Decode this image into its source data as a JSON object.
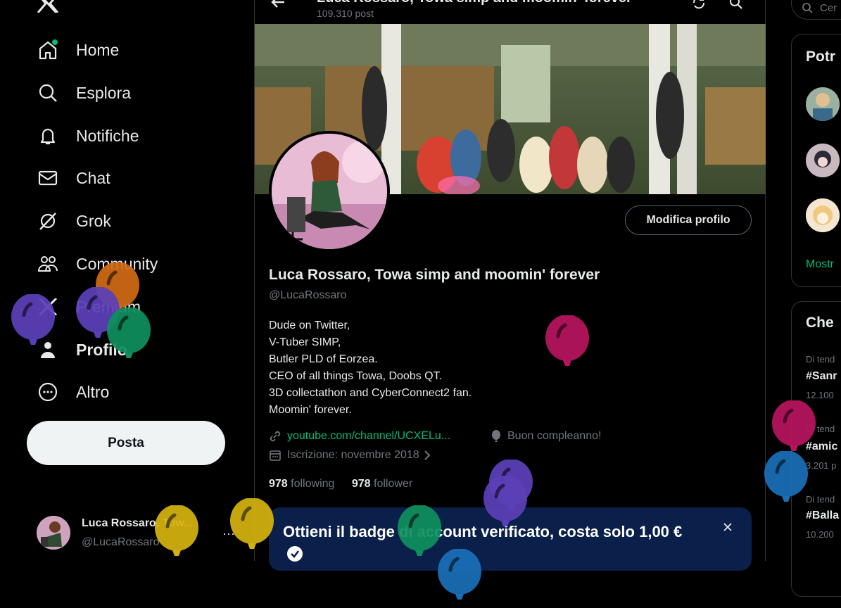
{
  "header": {
    "title": "Luca Rossaro, Towa simp and moomin' forever",
    "post_count": "109.310 post"
  },
  "nav": {
    "items": [
      {
        "label": "Home"
      },
      {
        "label": "Esplora"
      },
      {
        "label": "Notifiche"
      },
      {
        "label": "Chat"
      },
      {
        "label": "Grok"
      },
      {
        "label": "Community"
      },
      {
        "label": "Premium"
      },
      {
        "label": "Profilo"
      },
      {
        "label": "Altro"
      }
    ],
    "post_button": "Posta"
  },
  "profile": {
    "edit_button": "Modifica profilo",
    "name": "Luca Rossaro, Towa simp and moomin' forever",
    "handle": "@LucaRossaro",
    "bio_lines": [
      "Dude on Twitter,",
      "V-Tuber SIMP,",
      "Butler PLD of Eorzea.",
      "CEO of all things Towa, Doobs QT.",
      "3D collectathon and CyberConnect2 fan.",
      "Moomin' forever."
    ],
    "link": "youtube.com/channel/UCXELu...",
    "birthday": "Buon compleanno!",
    "joined": "Iscrizione: novembre 2018",
    "following_count": "978",
    "following_label": "following",
    "follower_count": "978",
    "follower_label": "follower"
  },
  "verify_banner": {
    "text": "Ottieni il badge di account verificato, costa solo 1,00 €"
  },
  "account": {
    "name": "Luca Rossaro, Tow...",
    "handle": "@LucaRossaro",
    "more": "···"
  },
  "right": {
    "search_placeholder": "Cer",
    "card1_title": "Potr",
    "show_more": "Mostr",
    "card2_title": "Che",
    "trends": [
      {
        "context": "Di tend",
        "tag": "#Sanr",
        "count": "12.100"
      },
      {
        "context": "Di tend",
        "tag": "#amic",
        "count": "3.201 p"
      },
      {
        "context": "Di tend",
        "tag": "#Balla",
        "count": "10.200"
      }
    ]
  },
  "colors": {
    "accent": "#1d9bf0",
    "link_green": "#00ba7c",
    "verify_bg": "#0a1f4a",
    "balloons": [
      "#5b3fb8",
      "#d06a14",
      "#0e8f5c",
      "#b8145f",
      "#d4b310",
      "#1a6fb8"
    ]
  }
}
